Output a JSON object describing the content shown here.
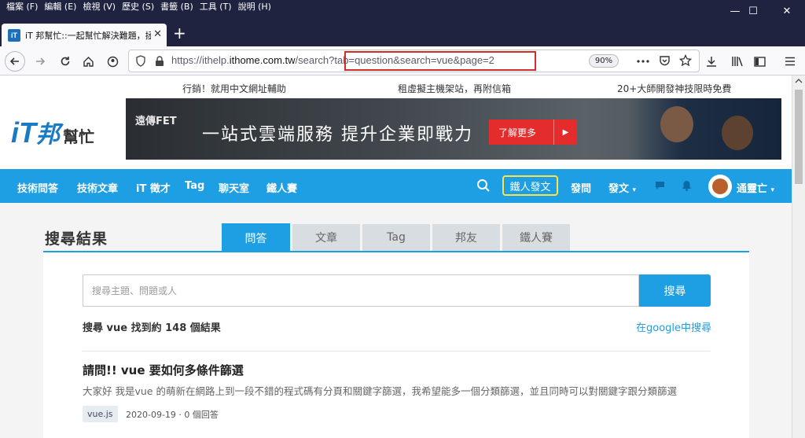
{
  "menubar": {
    "items": [
      "檔案 (F)",
      "編輯 (E)",
      "檢視 (V)",
      "歷史 (S)",
      "書籤 (B)",
      "工具 (T)",
      "說明 (H)"
    ]
  },
  "browser": {
    "tab_title": "iT 邦幫忙::一起幫忙解決難題，拯救 IT 人的一天",
    "url_host_prefix": "https://ithelp.",
    "url_host": "ithome.com.tw",
    "url_path": "/search",
    "url_query": "?tab=question&search=vue&page=2",
    "zoom": "90%",
    "window_minimize": "—",
    "window_maximize": "☐",
    "window_close": "✕",
    "new_tab": "+",
    "tab_close": "✕"
  },
  "site": {
    "promos": [
      "行銷！就用中文網址輔助",
      "租虛擬主機架站，再附信箱",
      "20+大師開發神技限時免費"
    ],
    "logo": {
      "it": "iT",
      "bang": "邦",
      "bangmang": "幫忙"
    },
    "banner": {
      "brand": "遠傳FET",
      "headline": "一站式雲端服務  提升企業即戰力",
      "cta": "了解更多",
      "cta_arrow": "▶"
    },
    "nav": {
      "items": [
        "技術問答",
        "技術文章",
        "iT 徵才",
        "Tag",
        "聊天室",
        "鐵人賽"
      ],
      "iron_post": "鐵人發文",
      "ask": "發問",
      "post": "發文",
      "username": "通靈亡",
      "caret": "▾"
    }
  },
  "search": {
    "heading": "搜尋結果",
    "tabs": [
      "問答",
      "文章",
      "Tag",
      "邦友",
      "鐵人賽"
    ],
    "active_tab": "問答",
    "placeholder": "搜尋主題、問題或人",
    "button": "搜尋",
    "result_count": "搜尋 vue 找到約 148 個結果",
    "google_link": "在google中搜尋"
  },
  "results": [
    {
      "title": "請問!! vue 要如何多條件篩選",
      "excerpt": "大家好 我是vue 的萌新在網路上到一段不錯的程式碼有分頁和關鍵字篩選，我希望能多一個分類篩選，並且同時可以對關鍵字跟分類篩選",
      "tag": "vue.js",
      "meta": "2020-09-19 · 0 個回答"
    }
  ]
}
